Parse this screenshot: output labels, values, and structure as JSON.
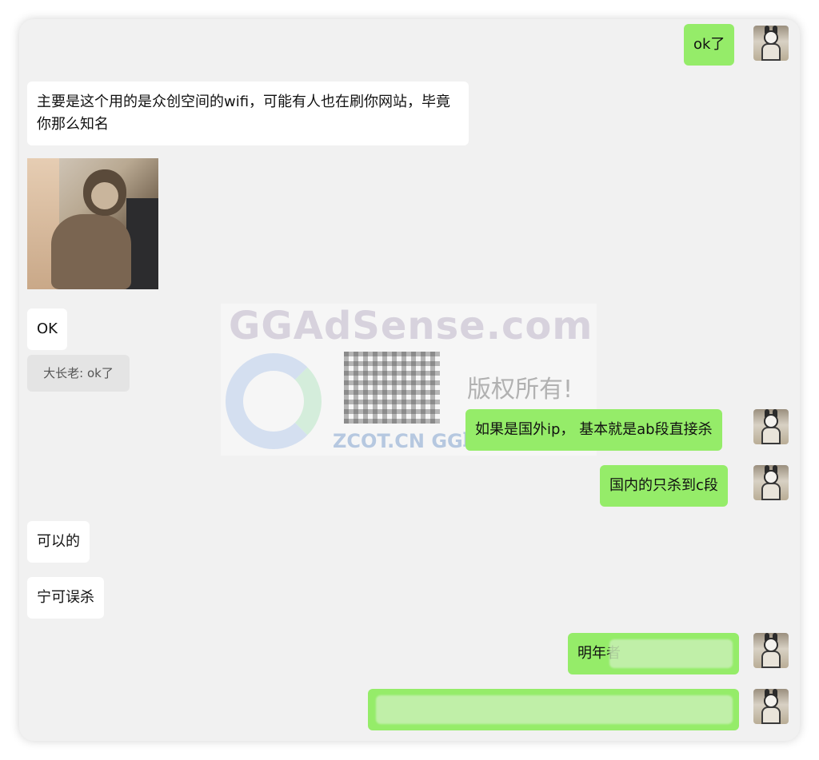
{
  "messages": [
    {
      "id": "m1",
      "side": "right",
      "text": "ok了",
      "blurred": false
    },
    {
      "id": "m2",
      "side": "left",
      "text": "主要是这个用的是众创空间的wifi，可能有人也在刷你网站，毕竟你那么知名"
    },
    {
      "id": "m3",
      "side": "left",
      "type": "sticker",
      "icon": "monkey-sticker"
    },
    {
      "id": "m4",
      "side": "left",
      "text": "OK"
    },
    {
      "id": "m5",
      "type": "quote",
      "text": "大长老: ok了"
    },
    {
      "id": "m6",
      "side": "right",
      "text": "如果是国外ip， 基本就是ab段直接杀"
    },
    {
      "id": "m7",
      "side": "right",
      "text": "国内的只杀到c段"
    },
    {
      "id": "m8",
      "side": "left",
      "text": "可以的"
    },
    {
      "id": "m9",
      "side": "left",
      "text": "宁可误杀"
    },
    {
      "id": "m10",
      "side": "right",
      "text": "明年者",
      "blurred": true
    },
    {
      "id": "m11",
      "side": "right",
      "text": "",
      "blurred": true
    }
  ],
  "watermark": {
    "title": "GGAdSense.com",
    "rights": "版权所有!",
    "sub": "ZCOT.CN GG联盟挑战"
  },
  "colors": {
    "self_bubble": "#95ec69",
    "other_bubble": "#ffffff",
    "background": "#f1f1f1"
  }
}
